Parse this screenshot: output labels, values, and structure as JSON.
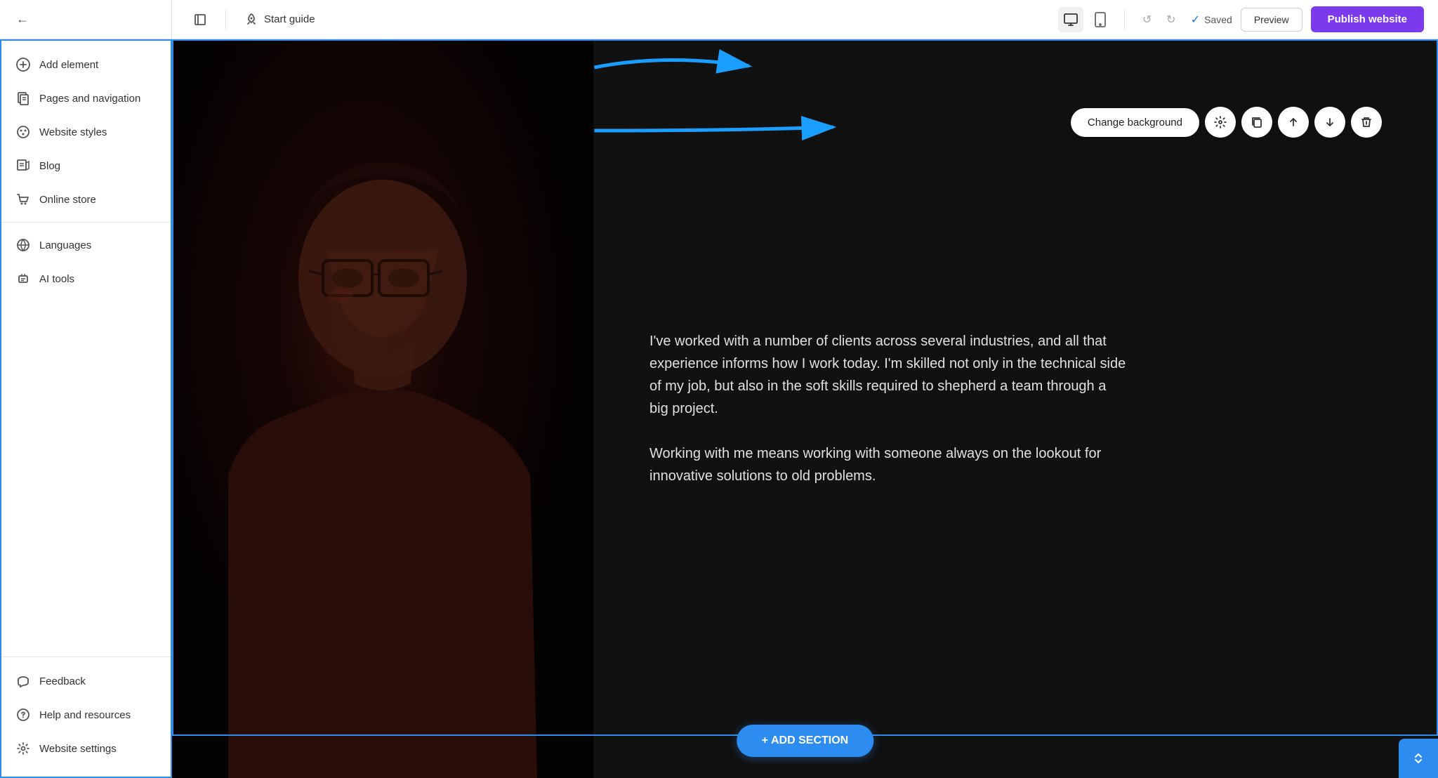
{
  "topbar": {
    "back_label": "←",
    "start_guide_label": "Start guide",
    "undo_symbol": "↺",
    "redo_symbol": "↻",
    "saved_label": "Saved",
    "preview_label": "Preview",
    "publish_label": "Publish website"
  },
  "sidebar": {
    "items": [
      {
        "id": "add-element",
        "label": "Add element",
        "icon": "➕"
      },
      {
        "id": "pages-navigation",
        "label": "Pages and navigation",
        "icon": "📄"
      },
      {
        "id": "website-styles",
        "label": "Website styles",
        "icon": "🎨"
      },
      {
        "id": "blog",
        "label": "Blog",
        "icon": "✏️"
      },
      {
        "id": "online-store",
        "label": "Online store",
        "icon": "🛒"
      },
      {
        "id": "languages",
        "label": "Languages",
        "icon": "🌐"
      },
      {
        "id": "ai-tools",
        "label": "AI tools",
        "icon": "🤖"
      }
    ],
    "bottom_items": [
      {
        "id": "feedback",
        "label": "Feedback",
        "icon": "📢"
      },
      {
        "id": "help-resources",
        "label": "Help and resources",
        "icon": "❓"
      },
      {
        "id": "website-settings",
        "label": "Website settings",
        "icon": "⚙️"
      }
    ]
  },
  "toolbar": {
    "change_background_label": "Change background",
    "settings_icon": "⚙",
    "copy_icon": "⧉",
    "move_up_icon": "↑",
    "move_down_icon": "↓",
    "delete_icon": "🗑"
  },
  "canvas": {
    "content_paragraph_1": "I've worked with a number of clients across several industries, and all that experience informs how I work today. I'm skilled not only in the technical side of my job, but also in the soft skills required to shepherd a team through a big project.",
    "content_paragraph_2": "Working with me means working with someone always on the lookout for innovative solutions to old problems."
  },
  "add_section": {
    "label": "+ ADD SECTION"
  }
}
